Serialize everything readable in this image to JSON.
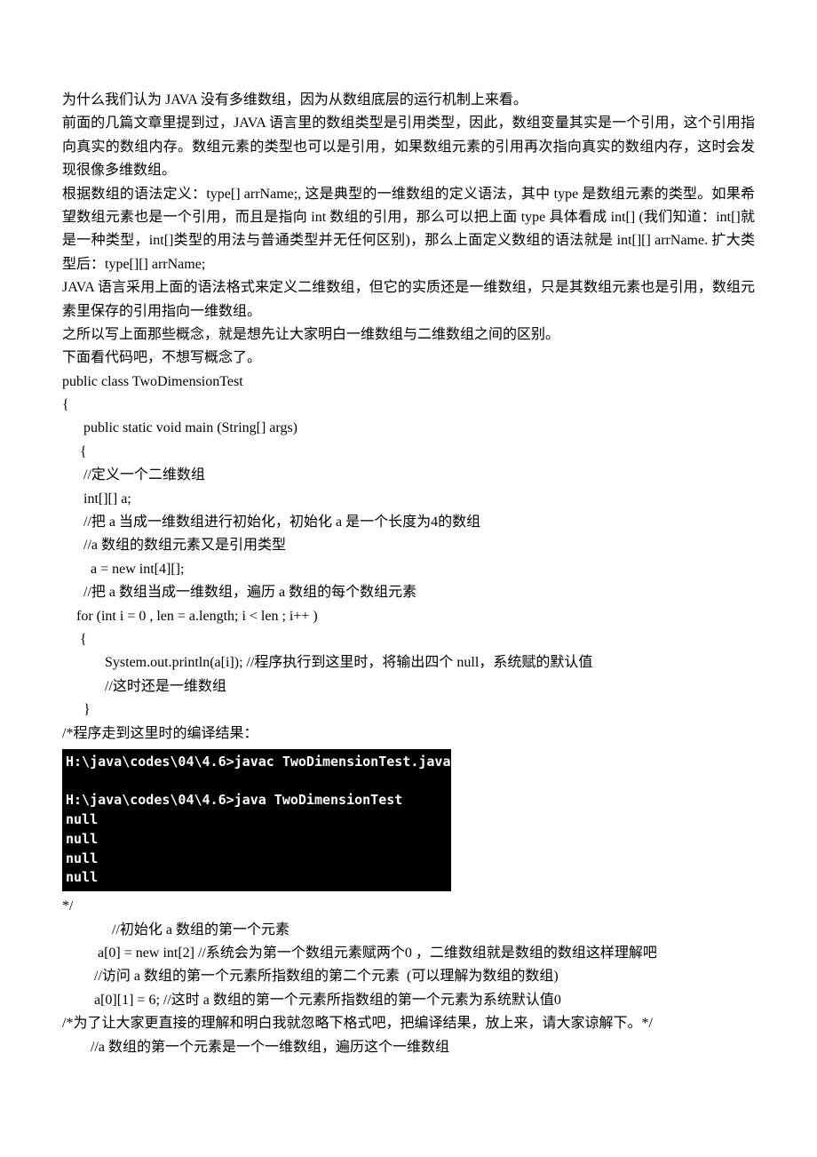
{
  "p1": "为什么我们认为 JAVA 没有多维数组，因为从数组底层的运行机制上来看。",
  "p2": "前面的几篇文章里提到过，JAVA 语言里的数组类型是引用类型，因此，数组变量其实是一个引用，这个引用指向真实的数组内存。数组元素的类型也可以是引用，如果数组元素的引用再次指向真实的数组内存，这时会发现很像多维数组。",
  "p3": "根据数组的语法定义：type[] arrName;, 这是典型的一维数组的定义语法，其中 type 是数组元素的类型。如果希望数组元素也是一个引用，而且是指向 int 数组的引用，那么可以把上面 type 具体看成 int[] (我们知道：int[]就是一种类型，int[]类型的用法与普通类型并无任何区别)，那么上面定义数组的语法就是 int[][] arrName.  扩大类型后：type[][] arrName;",
  "p4": "JAVA 语言采用上面的语法格式来定义二维数组，但它的实质还是一维数组，只是其数组元素也是引用，数组元素里保存的引用指向一维数组。",
  "p5": "之所以写上面那些概念，就是想先让大家明白一维数组与二维数组之间的区别。",
  "p6": "下面看代码吧，不想写概念了。",
  "code": {
    "l1": "public class TwoDimensionTest",
    "l2": "{",
    "l3": "      public static void main (String[] args)",
    "l4": "     {",
    "l5": "      //定义一个二维数组",
    "l6": "      int[][] a;",
    "l7": "      //把 a 当成一维数组进行初始化，初始化 a 是一个长度为4的数组",
    "l8": "      //a 数组的数组元素又是引用类型",
    "l9": "        a = new int[4][];",
    "l10": "      //把 a 数组当成一维数组，遍历 a 数组的每个数组元素",
    "l11": "    for (int i = 0 , len = a.length; i < len ; i++ )",
    "l12": "     {",
    "l13": "            System.out.println(a[i]); //程序执行到这里时，将输出四个 null，系统赋的默认值",
    "l14": "            //这时还是一维数组",
    "l15": "      }",
    "l16": "/*程序走到这里时的编译结果："
  },
  "terminal": "H:\\java\\codes\\04\\4.6>javac TwoDimensionTest.java\n\nH:\\java\\codes\\04\\4.6>java TwoDimensionTest\nnull\nnull\nnull\nnull",
  "after": {
    "l1": "*/",
    "l2": "              //初始化 a 数组的第一个元素",
    "l3": "          a[0] = new int[2] //系统会为第一个数组元素赋两个0 ，二维数组就是数组的数组这样理解吧",
    "l4": "",
    "l5": "         //访问 a 数组的第一个元素所指数组的第二个元素  (可以理解为数组的数组)",
    "l6": "         a[0][1] = 6; //这时 a 数组的第一个元素所指数组的第一个元素为系统默认值0",
    "l7": "/*为了让大家更直接的理解和明白我就忽略下格式吧，把编译结果，放上来，请大家谅解下。*/",
    "l8": "        //a 数组的第一个元素是一个一维数组，遍历这个一维数组"
  }
}
